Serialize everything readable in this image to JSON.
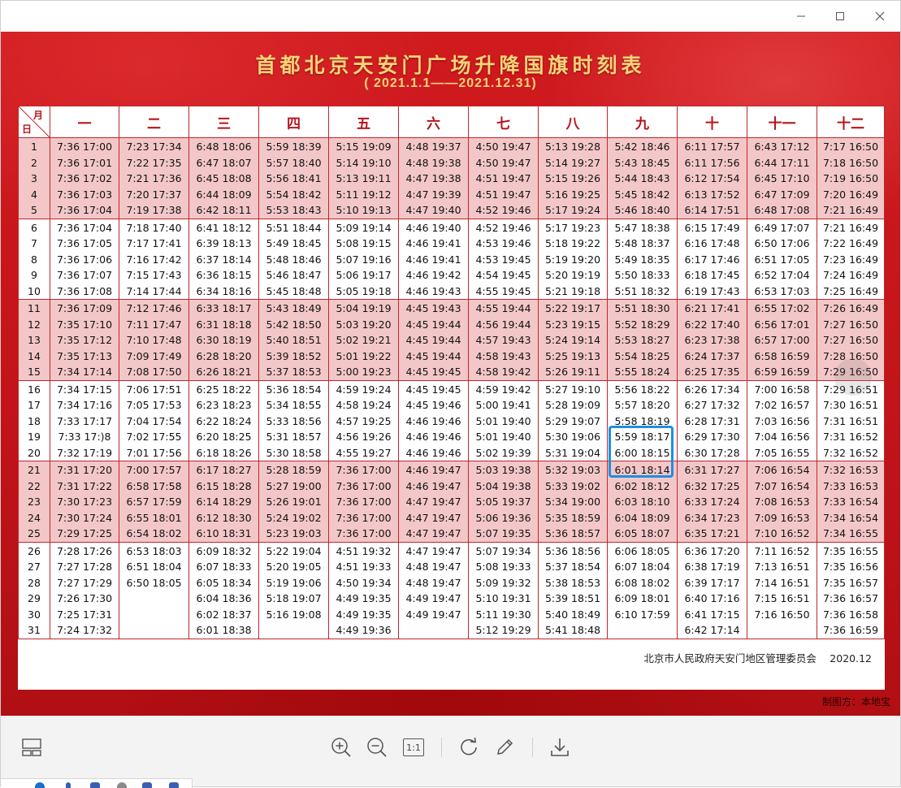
{
  "poster": {
    "title": "首都北京天安门广场升降国旗时刻表",
    "subtitle": "( 2021.1.1——2021.12.31)",
    "corner_month": "月",
    "corner_day": "日",
    "months": [
      "一",
      "二",
      "三",
      "四",
      "五",
      "六",
      "七",
      "八",
      "九",
      "十",
      "十一",
      "十二"
    ],
    "day_groups": [
      [
        "1",
        "2",
        "3",
        "4",
        "5"
      ],
      [
        "6",
        "7",
        "8",
        "9",
        "10"
      ],
      [
        "11",
        "12",
        "13",
        "14",
        "15"
      ],
      [
        "16",
        "17",
        "18",
        "19",
        "20"
      ],
      [
        "21",
        "22",
        "23",
        "24",
        "25"
      ],
      [
        "26",
        "27",
        "28",
        "29",
        "30",
        "31"
      ]
    ],
    "times": [
      [
        [
          "7:36 17:00",
          "7:36 17:01",
          "7:36 17:02",
          "7:36 17:03",
          "7:36 17:04"
        ],
        [
          "7:23 17:34",
          "7:22 17:35",
          "7:21 17:36",
          "7:20 17:37",
          "7:19 17:38"
        ],
        [
          "6:48 18:06",
          "6:47 18:07",
          "6:45 18:08",
          "6:44 18:09",
          "6:42 18:11"
        ],
        [
          "5:59 18:39",
          "5:57 18:40",
          "5:56 18:41",
          "5:54 18:42",
          "5:53 18:43"
        ],
        [
          "5:15 19:09",
          "5:14 19:10",
          "5:13 19:11",
          "5:11 19:12",
          "5:10 19:13"
        ],
        [
          "4:48 19:37",
          "4:48 19:38",
          "4:47 19:38",
          "4:47 19:39",
          "4:47 19:40"
        ],
        [
          "4:50 19:47",
          "4:50 19:47",
          "4:51 19:47",
          "4:51 19:47",
          "4:52 19:46"
        ],
        [
          "5:13 19:28",
          "5:14 19:27",
          "5:15 19:26",
          "5:16 19:25",
          "5:17 19:24"
        ],
        [
          "5:42 18:46",
          "5:43 18:45",
          "5:44 18:43",
          "5:45 18:42",
          "5:46 18:40"
        ],
        [
          "6:11 17:57",
          "6:11 17:56",
          "6:12 17:54",
          "6:13 17:52",
          "6:14 17:51"
        ],
        [
          "6:43 17:12",
          "6:44 17:11",
          "6:45 17:10",
          "6:47 17:09",
          "6:48 17:08"
        ],
        [
          "7:17 16:50",
          "7:18 16:50",
          "7:19 16:50",
          "7:20 16:49",
          "7:21 16:49"
        ]
      ],
      [
        [
          "7:36 17:04",
          "7:36 17:05",
          "7:36 17:06",
          "7:36 17:07",
          "7:36 17:08"
        ],
        [
          "7:18 17:40",
          "7:17 17:41",
          "7:16 17:42",
          "7:15 17:43",
          "7:14 17:44"
        ],
        [
          "6:41 18:12",
          "6:39 18:13",
          "6:37 18:14",
          "6:36 18:15",
          "6:34 18:16"
        ],
        [
          "5:51 18:44",
          "5:49 18:45",
          "5:48 18:46",
          "5:46 18:47",
          "5:45 18:48"
        ],
        [
          "5:09 19:14",
          "5:08 19:15",
          "5:07 19:16",
          "5:06 19:17",
          "5:05 19:18"
        ],
        [
          "4:46 19:40",
          "4:46 19:41",
          "4:46 19:41",
          "4:46 19:42",
          "4:46 19:43"
        ],
        [
          "4:52 19:46",
          "4:53 19:46",
          "4:53 19:45",
          "4:54 19:45",
          "4:55 19:45"
        ],
        [
          "5:17 19:23",
          "5:18 19:22",
          "5:19 19:20",
          "5:20 19:19",
          "5:21 19:18"
        ],
        [
          "5:47 18:38",
          "5:48 18:37",
          "5:49 18:35",
          "5:50 18:33",
          "5:51 18:32"
        ],
        [
          "6:15 17:49",
          "6:16 17:48",
          "6:17 17:46",
          "6:18 17:45",
          "6:19 17:43"
        ],
        [
          "6:49 17:07",
          "6:50 17:06",
          "6:51 17:05",
          "6:52 17:04",
          "6:53 17:03"
        ],
        [
          "7:21 16:49",
          "7:22 16:49",
          "7:23 16:49",
          "7:24 16:49",
          "7:25 16:49"
        ]
      ],
      [
        [
          "7:36 17:09",
          "7:35 17:10",
          "7:35 17:12",
          "7:35 17:13",
          "7:34 17:14"
        ],
        [
          "7:12 17:46",
          "7:11 17:47",
          "7:10 17:48",
          "7:09 17:49",
          "7:08 17:50"
        ],
        [
          "6:33 18:17",
          "6:31 18:18",
          "6:30 18:19",
          "6:28 18:20",
          "6:26 18:21"
        ],
        [
          "5:43 18:49",
          "5:42 18:50",
          "5:40 18:51",
          "5:39 18:52",
          "5:37 18:53"
        ],
        [
          "5:04 19:19",
          "5:03 19:20",
          "5:02 19:21",
          "5:01 19:22",
          "5:00 19:23"
        ],
        [
          "4:45 19:43",
          "4:45 19:44",
          "4:45 19:44",
          "4:45 19:44",
          "4:45 19:45"
        ],
        [
          "4:55 19:44",
          "4:56 19:44",
          "4:57 19:43",
          "4:58 19:43",
          "4:58 19:42"
        ],
        [
          "5:22 19:17",
          "5:23 19:15",
          "5:24 19:14",
          "5:25 19:13",
          "5:26 19:11"
        ],
        [
          "5:51 18:30",
          "5:52 18:29",
          "5:53 18:27",
          "5:54 18:25",
          "5:55 18:24"
        ],
        [
          "6:21 17:41",
          "6:22 17:40",
          "6:23 17:38",
          "6:24 17:37",
          "6:25 17:35"
        ],
        [
          "6:55 17:02",
          "6:56 17:01",
          "6:57 17:00",
          "6:58 16:59",
          "6:59 16:59"
        ],
        [
          "7:26 16:49",
          "7:27 16:50",
          "7:27 16:50",
          "7:28 16:50",
          "7:29 16:50"
        ]
      ],
      [
        [
          "7:34 17:15",
          "7:34 17:16",
          "7:33 17:17",
          "7:33 17:)8",
          "7:32 17:19"
        ],
        [
          "7:06 17:51",
          "7:05 17:53",
          "7:04 17:54",
          "7:02 17:55",
          "7:01 17:56"
        ],
        [
          "6:25 18:22",
          "6:23 18:23",
          "6:22 18:24",
          "6:20 18:25",
          "6:18 18:26"
        ],
        [
          "5:36 18:54",
          "5:34 18:55",
          "5:33 18:56",
          "5:31 18:57",
          "5:30 18:58"
        ],
        [
          "4:59 19:24",
          "4:58 19:24",
          "4:57 19:25",
          "4:56 19:26",
          "4:55 19:27"
        ],
        [
          "4:45 19:45",
          "4:45 19:46",
          "4:46 19:46",
          "4:46 19:46",
          "4:46 19:46"
        ],
        [
          "4:59 19:42",
          "5:00 19:41",
          "5:01 19:40",
          "5:01 19:40",
          "5:02 19:39"
        ],
        [
          "5:27 19:10",
          "5:28 19:09",
          "5:29 19:07",
          "5:30 19:06",
          "5:31 19:04"
        ],
        [
          "5:56 18:22",
          "5:57 18:20",
          "5:58 18:19",
          "5:59 18:17",
          "6:00 18:15"
        ],
        [
          "6:26 17:34",
          "6:27 17:32",
          "6:28 17:31",
          "6:29 17:30",
          "6:30 17:28"
        ],
        [
          "7:00 16:58",
          "7:02 16:57",
          "7:03 16:56",
          "7:04 16:56",
          "7:05 16:55"
        ],
        [
          "7:29 16:51",
          "7:30 16:51",
          "7:31 16:51",
          "7:31 16:52",
          "7:32 16:52"
        ]
      ],
      [
        [
          "7:31 17:20",
          "7:31 17:22",
          "7:30 17:23",
          "7:30 17:24",
          "7:29 17:25"
        ],
        [
          "7:00 17:57",
          "6:58 17:58",
          "6:57 17:59",
          "6:55 18:01",
          "6:54 18:02"
        ],
        [
          "6:17 18:27",
          "6:15 18:28",
          "6:14 18:29",
          "6:12 18:30",
          "6:10 18:31"
        ],
        [
          "5:28 18:59",
          "5:27 19:00",
          "5:26 19:01",
          "5:24 19:02",
          "5:23 19:03"
        ],
        [
          "7:36 17:00",
          "7:36 17:00",
          "7:36 17:00",
          "7:36 17:00",
          "7:36 17:00"
        ],
        [
          "4:46 19:47",
          "4:46 19:47",
          "4:47 19:47",
          "4:47 19:47",
          "4:47 19:47"
        ],
        [
          "5:03 19:38",
          "5:04 19:38",
          "5:05 19:37",
          "5:06 19:36",
          "5:07 19:35"
        ],
        [
          "5:32 19:03",
          "5:33 19:02",
          "5:34 19:00",
          "5:35 18:59",
          "5:36 18:57"
        ],
        [
          "6:01 18:14",
          "6:02 18:12",
          "6:03 18:10",
          "6:04 18:09",
          "6:05 18:07"
        ],
        [
          "6:31 17:27",
          "6:32 17:25",
          "6:33 17:24",
          "6:34 17:23",
          "6:35 17:21"
        ],
        [
          "7:06 16:54",
          "7:07 16:54",
          "7:08 16:53",
          "7:09 16:53",
          "7:10 16:52"
        ],
        [
          "7:32 16:53",
          "7:33 16:53",
          "7:33 16:54",
          "7:34 16:54",
          "7:34 16:55"
        ]
      ],
      [
        [
          "7:28 17:26",
          "7:27 17:28",
          "7:27 17:29",
          "7:26 17:30",
          "7:25 17:31",
          "7:24 17:32"
        ],
        [
          "6:53 18:03",
          "6:51 18:04",
          "6:50 18:05"
        ],
        [
          "6:09 18:32",
          "6:07 18:33",
          "6:05 18:34",
          "6:04 18:36",
          "6:02 18:37",
          "6:01 18:38"
        ],
        [
          "5:22 19:04",
          "5:20 19:05",
          "5:19 19:06",
          "5:18 19:07",
          "5:16 19:08"
        ],
        [
          "4:51 19:32",
          "4:51 19:33",
          "4:50 19:34",
          "4:49 19:35",
          "4:49 19:35",
          "4:49 19:36"
        ],
        [
          "4:47 19:47",
          "4:48 19:47",
          "4:48 19:47",
          "4:49 19:47",
          "4:49 19:47"
        ],
        [
          "5:07 19:34",
          "5:08 19:33",
          "5:09 19:32",
          "5:10 19:31",
          "5:11 19:30",
          "5:12 19:29"
        ],
        [
          "5:36 18:56",
          "5:37 18:54",
          "5:38 18:53",
          "5:39 18:51",
          "5:40 18:49",
          "5:41 18:48"
        ],
        [
          "6:06 18:05",
          "6:07 18:04",
          "6:08 18:02",
          "6:09 18:01",
          "6:10 17:59"
        ],
        [
          "6:36 17:20",
          "6:38 17:19",
          "6:39 17:17",
          "6:40 17:16",
          "6:41 17:15",
          "6:42 17:14"
        ],
        [
          "7:11 16:52",
          "7:13 16:51",
          "7:14 16:51",
          "7:15 16:51",
          "7:16 16:50"
        ],
        [
          "7:35 16:55",
          "7:35 16:56",
          "7:35 16:57",
          "7:36 16:57",
          "7:36 16:58",
          "7:36 16:59"
        ]
      ]
    ],
    "footer_org": "北京市人民政府天安门地区管理委员会 　2020.12",
    "maker": "制图方：本地宝"
  },
  "icons": {
    "window_minimize": "minimize-icon",
    "window_maximize": "maximize-icon",
    "window_close": "close-icon",
    "thumbnails": "thumbnails-icon",
    "zoom_in": "zoom-in-icon",
    "zoom_out": "zoom-out-icon",
    "actual_size": "actual-size-icon",
    "rotate": "rotate-icon",
    "edit": "edit-icon",
    "download": "download-icon"
  },
  "toolbar": {
    "actual_size_label": "1:1"
  },
  "colors": {
    "poster_red": "#c2141a",
    "title_gold": "#f6d37a",
    "band_pink": "#f3c7c8",
    "grid_red": "#c0262c",
    "highlight_blue": "#1e8fe1"
  }
}
